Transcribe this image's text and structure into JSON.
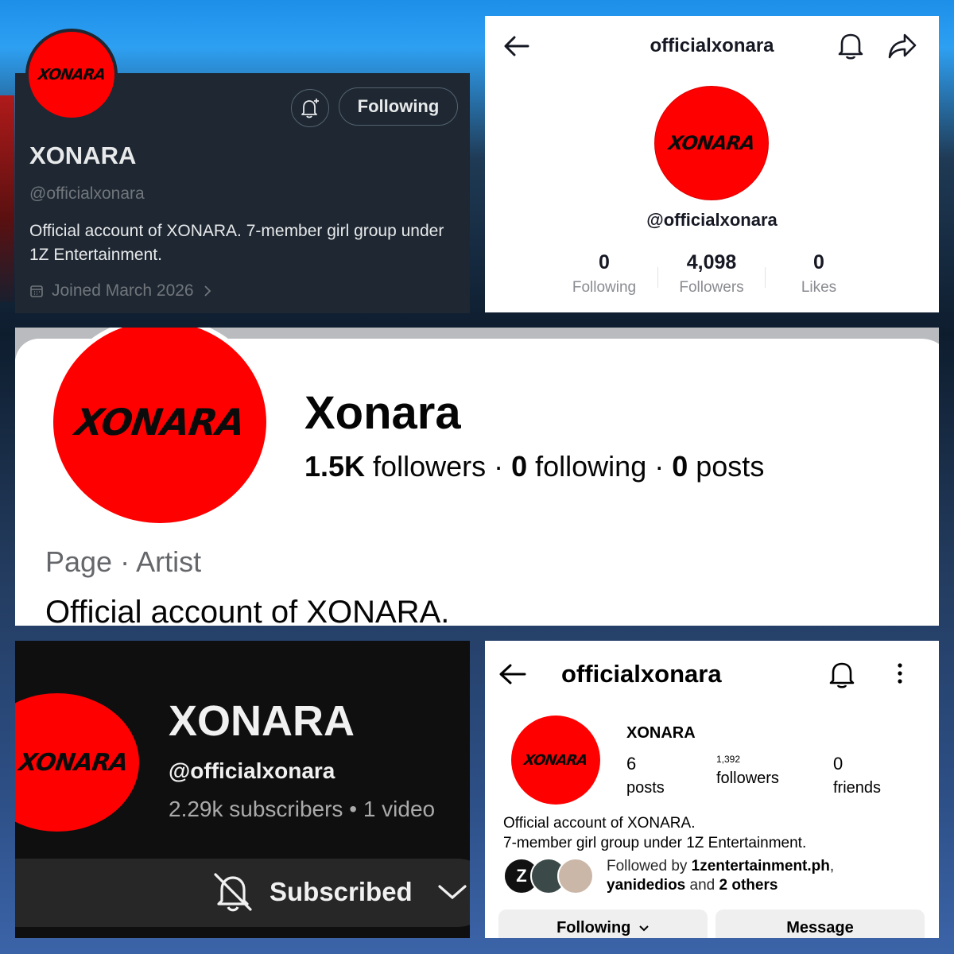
{
  "twitter": {
    "logo_text": "XONARA",
    "follow_button": "Following",
    "name": "XONARA",
    "handle": "@officialxonara",
    "bio": "Official account of XONARA. 7-member girl group under 1Z Entertainment.",
    "joined": "Joined March 2026",
    "icons": [
      "bell-plus-icon",
      "calendar-icon",
      "chevron-right-icon"
    ]
  },
  "tiktok": {
    "title": "officialxonara",
    "logo_text": "XONARA",
    "handle": "@officialxonara",
    "stats": [
      {
        "num": "0",
        "label": "Following"
      },
      {
        "num": "4,098",
        "label": "Followers"
      },
      {
        "num": "0",
        "label": "Likes"
      }
    ],
    "icons": [
      "back-arrow-icon",
      "bell-icon",
      "share-icon"
    ]
  },
  "facebook": {
    "logo_text": "XONARA",
    "name": "Xonara",
    "followers_num": "1.5K",
    "followers_label": " followers",
    "following_num": "0",
    "following_label": " following",
    "posts_num": "0",
    "posts_label": " posts",
    "category": "Page · Artist",
    "bio": "Official account of XONARA."
  },
  "youtube": {
    "logo_text": "XONARA",
    "name": "XONARA",
    "handle": "@officialxonara",
    "subscribers": "2.29k subscribers",
    "videos": "1 video",
    "subscribe_button": "Subscribed",
    "icons": [
      "bell-off-icon",
      "chevron-down-icon"
    ]
  },
  "instagram": {
    "title": "officialxonara",
    "logo_text": "XONARA",
    "username": "XONARA",
    "posts_num": "6",
    "posts_label": "posts",
    "followers_num": "1,392",
    "followers_label": "followers",
    "friends_num": "0",
    "friends_label": "friends",
    "bio_line1": "Official account of XONARA.",
    "bio_line2": "7-member girl group under 1Z Entertainment.",
    "followed_prefix": "Followed by ",
    "followed_user1": "1zentertainment.ph",
    "followed_sep": ",",
    "followed_user2": "yanidedios",
    "followed_and": " and ",
    "followed_others": "2 others",
    "following_button": "Following",
    "message_button": "Message",
    "icons": [
      "back-arrow-icon",
      "bell-icon",
      "more-vertical-icon"
    ]
  }
}
